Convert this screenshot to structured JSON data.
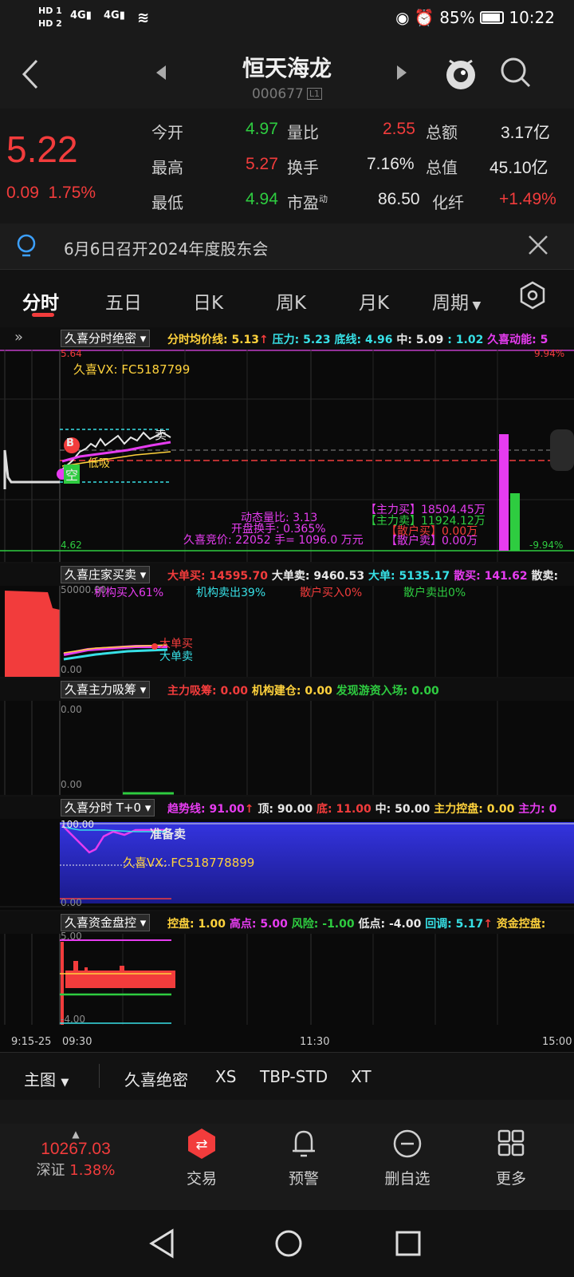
{
  "status_bar": {
    "hd1": "HD 1",
    "hd2": "HD 2",
    "net1": "4G",
    "net2": "4G",
    "battery": "85%",
    "time": "10:22"
  },
  "header": {
    "title": "恒天海龙",
    "code": "000677",
    "level": "L1"
  },
  "quote": {
    "price": "5.22",
    "change": "0.09",
    "change_pct": "1.75%",
    "rows": [
      {
        "l1": "今开",
        "v1": "4.97",
        "l2": "量比",
        "v2": "2.55",
        "l3": "总额",
        "v3": "3.17亿"
      },
      {
        "l1": "最高",
        "v1": "5.27",
        "l2": "换手",
        "v2": "7.16%",
        "l3": "总值",
        "v3": "45.10亿"
      },
      {
        "l1": "最低",
        "v1": "4.94",
        "l2": "市盈",
        "v2": "86.50",
        "l3": "化纤",
        "v3": "+1.49%"
      }
    ],
    "pe_sup": "动"
  },
  "notice": {
    "text": "6月6日召开2024年度股东会"
  },
  "tabs": [
    "分时",
    "五日",
    "日K",
    "周K",
    "月K",
    "周期"
  ],
  "ind1": {
    "name": "久喜分时绝密",
    "vals": [
      "分时均价线: 5.13",
      "压力: 5.23",
      "底线: 4.96",
      "中: 5.09",
      ": 1.02",
      "久喜动能: 5"
    ],
    "top_price": "5.64",
    "bot_price": "4.62",
    "top_pct": "9.94%",
    "bot_pct": "-9.94%",
    "watermark": "久喜VX:  FC5187799",
    "b_label": "B",
    "kong": "空",
    "buy_label": "低吸",
    "sell_label": "卖",
    "dyn_ratio": "动态量比:  3.13",
    "open_turn": "开盘换手:  0.365%",
    "auction": "久喜竞价:   22052 手= 1096.0 万元",
    "main_buy": "【主力买】18504.45万",
    "main_sell": "【主力卖】11924.12万",
    "retail_buy": "【散户买】0.00万",
    "retail_sell": "【散户卖】0.00万"
  },
  "ind2": {
    "name": "久喜庄家买卖",
    "vals": [
      "大单买: 14595.70",
      "大单卖: 9460.53",
      "大单: 5135.17",
      "散买: 141.62",
      "散卖:"
    ],
    "top": "50000.00",
    "bot": "0.00",
    "inst_buy": "机构买入61%",
    "inst_sell": "机构卖出39%",
    "ret_buy": "散户买入0%",
    "ret_sell": "散户卖出0%",
    "big_buy": "大单买",
    "big_sell": "大单卖"
  },
  "ind3": {
    "name": "久喜主力吸筹",
    "vals": [
      "主力吸筹: 0.00",
      "机构建仓: 0.00",
      "发现游资入场: 0.00"
    ],
    "top": "0.00",
    "bot": "0.00"
  },
  "ind4": {
    "name": "久喜分时 T+0",
    "vals": [
      "趋势线: 91.00",
      "顶: 90.00",
      "底: 11.00",
      "中: 50.00",
      "主力控盘: 0.00",
      "主力: 0"
    ],
    "top": "100.00",
    "bot": "0.00",
    "ready_sell": "准备卖",
    "watermark": "久喜VX:  FC518778899"
  },
  "ind5": {
    "name": "久喜资金盘控",
    "vals": [
      "控盘: 1.00",
      "高点: 5.00",
      "风险: -1.00",
      "低点: -4.00",
      "回调: 5.17",
      "资金控盘:"
    ],
    "top": "5.00",
    "bot": "-4.00"
  },
  "time_axis": {
    "pre": "9:15-25",
    "t0": "09:30",
    "t1": "11:30",
    "t2": "15:00"
  },
  "main_selector": {
    "main": "主图",
    "items": [
      "久喜绝密",
      "XS",
      "TBP-STD",
      "XT"
    ]
  },
  "bottom_nav": {
    "index_value": "10267.03",
    "index_name": "深证",
    "index_pct": "1.38%",
    "items": [
      "交易",
      "预警",
      "删自选",
      "更多"
    ]
  },
  "colors": {
    "red": "#f23c3c",
    "green": "#2ecc40",
    "blue_panel": "#2a2ad8",
    "magenta": "#e63cf0"
  }
}
